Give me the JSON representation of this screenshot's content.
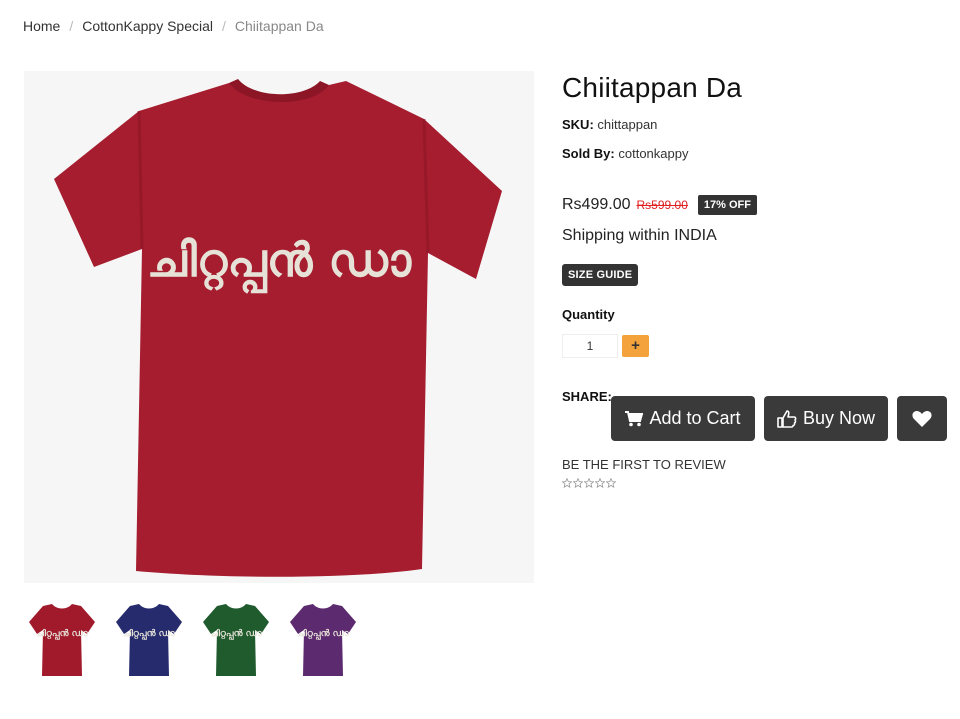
{
  "breadcrumb": {
    "items": [
      "Home",
      "CottonKappy Special"
    ],
    "current": "Chiitappan Da",
    "separator": "/"
  },
  "product": {
    "title": "Chiitappan Da",
    "sku_label": "SKU:",
    "sku_value": "chittappan",
    "sold_by_label": "Sold By:",
    "sold_by_value": "cottonkappy",
    "price": "Rs499.00",
    "old_price": "Rs599.00",
    "discount": "17% OFF",
    "shipping": "Shipping within INDIA",
    "size_guide": "SIZE GUIDE",
    "image_print_text": "ചിറ്റപ്പൻ ഡാ"
  },
  "quantity": {
    "label": "Quantity",
    "value": "1",
    "plus": "+"
  },
  "share": {
    "label": "SHARE:"
  },
  "actions": {
    "add_to_cart": "Add to Cart",
    "buy_now": "Buy Now"
  },
  "review": {
    "cta": "BE THE FIRST TO REVIEW",
    "rating": 0,
    "max": 5
  },
  "thumbnails": [
    {
      "name": "red",
      "color": "#a01a2c"
    },
    {
      "name": "navy",
      "color": "#262b6e"
    },
    {
      "name": "green",
      "color": "#1f5b2c"
    },
    {
      "name": "purple",
      "color": "#5c2a6e"
    }
  ],
  "colors": {
    "shirt_main": "#a51d2f",
    "badge_bg": "#333333",
    "plus_accent": "#f4a23c",
    "old_price": "#e02020",
    "button_bg": "#3a3a3a"
  }
}
